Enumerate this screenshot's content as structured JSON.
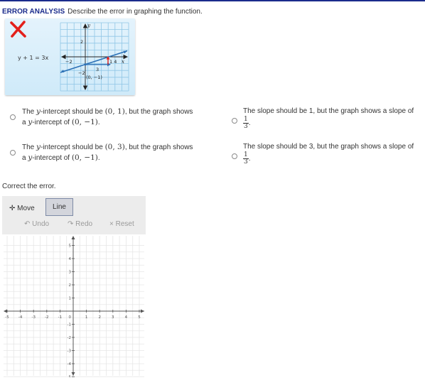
{
  "header": {
    "title": "ERROR ANALYSIS",
    "prompt": "Describe the error in graphing the function."
  },
  "figure": {
    "equation": "y + 1 = 3x",
    "y_axis_label": "y",
    "x_axis_label": "x",
    "tick_2_up": "2",
    "tick_neg2_left": "−2",
    "tick_neg2_down": "−2",
    "tick_14": "1 4",
    "rise_label": "3",
    "point_label": "(0, −1)",
    "colors": {
      "wrong_mark": "#e3201b",
      "line": "#2a6fb5",
      "grid": "#8fc6e6"
    }
  },
  "choices": [
    {
      "pre": "The",
      "var": "y",
      "mid": "-intercept should be",
      "value": "(0, 1)",
      "post": ", but the graph shows",
      "line2_pre": "a",
      "line2_var": "y",
      "line2_mid": "-intercept of",
      "line2_value": "(0, −1)",
      "line2_post": "."
    },
    {
      "text": "The slope should be 1, but the graph shows a slope of",
      "num": "1",
      "den": "3",
      "post": "."
    },
    {
      "pre": "The",
      "var": "y",
      "mid": "-intercept should be",
      "value": "(0, 3)",
      "post": ", but the graph shows",
      "line2_pre": "a",
      "line2_var": "y",
      "line2_mid": "-intercept of",
      "line2_value": "(0, −1)",
      "line2_post": "."
    },
    {
      "text": "The slope should be 3, but the graph shows a slope of",
      "num": "1",
      "den": "3",
      "post": "."
    }
  ],
  "correct_label": "Correct the error.",
  "toolbar": {
    "move_icon": "✛",
    "move_label": "Move",
    "line_label": "Line",
    "undo_icon": "↶",
    "undo_label": "Undo",
    "redo_icon": "↷",
    "redo_label": "Redo",
    "reset_icon": "×",
    "reset_label": "Reset"
  },
  "graph": {
    "x_ticks": [
      "-5",
      "-4",
      "-3",
      "-2",
      "-1",
      "1",
      "2",
      "3",
      "4",
      "5"
    ],
    "y_ticks": [
      "5",
      "4",
      "3",
      "2",
      "1",
      "-1",
      "-2",
      "-3",
      "-4",
      "-5"
    ],
    "origin_label": "0",
    "range": [
      -5,
      5
    ]
  }
}
